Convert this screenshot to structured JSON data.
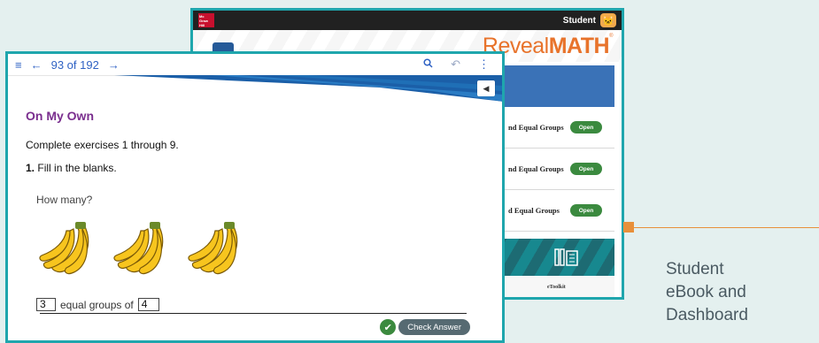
{
  "dashboard": {
    "header_user": "Student",
    "brand_reveal": "Reveal",
    "brand_math": "MATH",
    "brand_tm": "®",
    "lessons": [
      {
        "label": "nd Equal Groups",
        "button": "Open"
      },
      {
        "label": "nd Equal Groups",
        "button": "Open"
      },
      {
        "label": "d Equal Groups",
        "button": "Open"
      }
    ],
    "toolkit_label": "eToolkit"
  },
  "ebook": {
    "page_indicator": "93 of 192",
    "section_title": "On My Own",
    "instruction": "Complete exercises 1 through 9.",
    "exercise_number": "1.",
    "exercise_text": "Fill in the blanks.",
    "question": "How many?",
    "groups_value": "3",
    "equal_groups_text": "equal groups of",
    "group_size_value": "4",
    "check_button": "Check Answer"
  },
  "caption": "Student\neBook and\nDashboard",
  "colors": {
    "window_border": "#1fa6ad",
    "accent_orange": "#e8903a",
    "brand_orange": "#e8732b",
    "section_purple": "#7a2e8e",
    "open_green": "#3b8a3f",
    "nav_blue": "#2f62c4"
  },
  "icons": [
    "menu-icon",
    "back-arrow-icon",
    "forward-arrow-icon",
    "search-icon",
    "undo-icon",
    "more-vert-icon",
    "speaker-icon",
    "check-circle-icon",
    "toolkit-icon",
    "avatar-icon",
    "banana-icon"
  ]
}
